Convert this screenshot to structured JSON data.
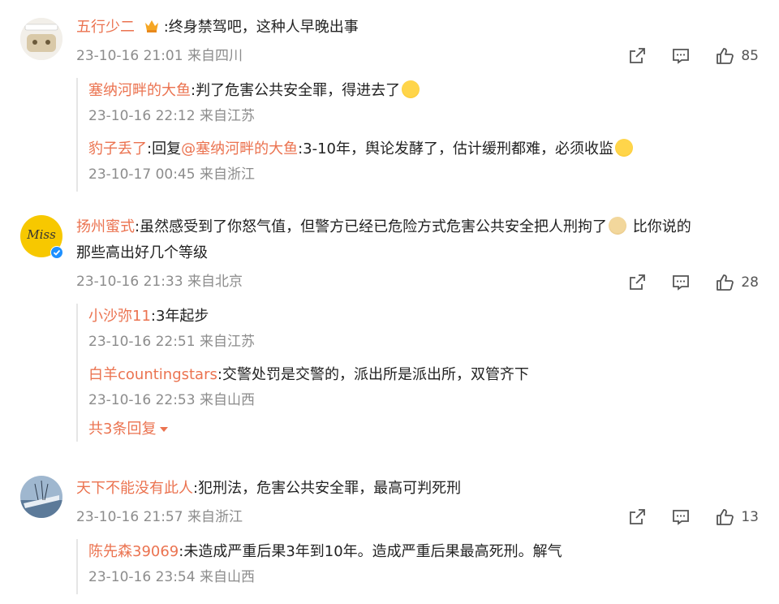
{
  "comments": [
    {
      "user": "五行少二",
      "text": ":终身禁驾吧，这种人早晚出事",
      "time": "23-10-16 21:01 来自四川",
      "likes": "85",
      "replies": [
        {
          "user": "塞纳河畔的大鱼",
          "text": ":判了危害公共安全罪，得进去了",
          "time": "23-10-16 22:12 来自江苏"
        },
        {
          "user": "豹子丢了",
          "text_prefix": ":回复",
          "mention": "@塞纳河畔的大鱼",
          "text": ":3-10年，舆论发酵了，估计缓刑都难，必须收监",
          "time": "23-10-17 00:45 来自浙江"
        }
      ]
    },
    {
      "user": "扬州蜜式",
      "text_line1": ":虽然感受到了你怒气值，但警方已经已危险方式危害公共安全把人刑拘了",
      "text_line1b": " 比你说的",
      "text_line2": "那些高出好几个等级",
      "time": "23-10-16 21:33 来自北京",
      "likes": "28",
      "replies": [
        {
          "user": "小沙弥11",
          "text": ":3年起步",
          "time": "23-10-16 22:51 来自江苏"
        },
        {
          "user": "白羊countingstars",
          "text": ":交警处罚是交警的，派出所是派出所，双管齐下",
          "time": "23-10-16 22:53 来自山西"
        }
      ],
      "more_replies": "共3条回复"
    },
    {
      "user": "天下不能没有此人",
      "text": ":犯刑法，危害公共安全罪，最高可判死刑",
      "time": "23-10-16 21:57 来自浙江",
      "likes": "13",
      "replies": [
        {
          "user": "陈先森39069",
          "text": ":未造成严重后果3年到10年。造成严重后果最高死刑。解气",
          "time": "23-10-16 23:54 来自山西"
        }
      ]
    }
  ],
  "avatar2_text": "Miss",
  "colors": {
    "username": "#eb7350",
    "meta": "#8c8c8c",
    "text": "#222222",
    "verified": "#1e90ff"
  },
  "icons": [
    "share-icon",
    "comment-icon",
    "like-icon",
    "caret-down-icon",
    "emoji-icon",
    "verified-badge-icon"
  ]
}
